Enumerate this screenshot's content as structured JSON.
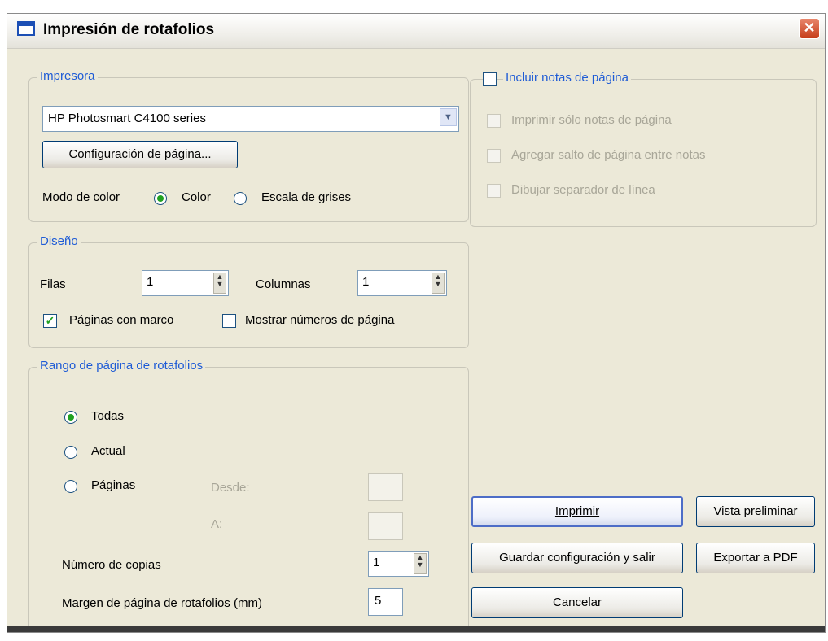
{
  "title": "Impresión de rotafolios",
  "printer": {
    "legend": "Impresora",
    "selected": "HP Photosmart C4100 series",
    "setup_button": "Configuración de página...",
    "color_mode_label": "Modo de color",
    "color_option": "Color",
    "gray_option": "Escala de grises",
    "color_mode_selected": "Color"
  },
  "layout": {
    "legend": "Diseño",
    "rows_label": "Filas",
    "rows_value": "1",
    "cols_label": "Columnas",
    "cols_value": "1",
    "framed_label": "Páginas con marco",
    "framed_checked": true,
    "page_numbers_label": "Mostrar números de página",
    "page_numbers_checked": false
  },
  "range": {
    "legend": "Rango de página de rotafolios",
    "all_label": "Todas",
    "current_label": "Actual",
    "pages_label": "Páginas",
    "selected": "Todas",
    "from_label": "Desde:",
    "from_value": "",
    "to_label": "A:",
    "to_value": "",
    "copies_label": "Número de copias",
    "copies_value": "1",
    "margin_label": "Margen de página de rotafolios (mm)",
    "margin_value": "5"
  },
  "notes": {
    "include_label": "Incluir notas de página",
    "include_checked": false,
    "only_notes_label": "Imprimir sólo notas de página",
    "page_break_label": "Agregar salto de página entre notas",
    "separator_label": "Dibujar separador de línea"
  },
  "buttons": {
    "print": "Imprimir",
    "preview": "Vista preliminar",
    "save_exit": "Guardar configuración y salir",
    "export_pdf": "Exportar a PDF",
    "cancel": "Cancelar"
  },
  "icons": {
    "close": "close-icon",
    "dropdown": "chevron-down-icon",
    "spinner": "spin-arrows-icon",
    "app": "window-icon"
  }
}
